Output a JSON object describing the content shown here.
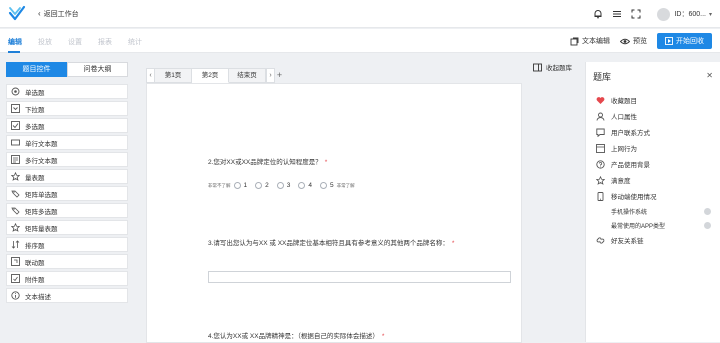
{
  "header": {
    "back_label": "返回工作台",
    "user_id": "ID：600...",
    "icons": [
      "bell-icon",
      "menu-icon",
      "expand-icon",
      "avatar",
      "chevron-down-icon"
    ]
  },
  "steps": {
    "items": [
      "编辑",
      "投放",
      "设置",
      "报表",
      "统计"
    ],
    "active_index": 0
  },
  "actions": {
    "text_edit": "文本编辑",
    "preview": "预览",
    "start": "开始回收"
  },
  "colors": {
    "accent": "#1e88e5",
    "required": "#e5484d",
    "heart": "#e5484d"
  },
  "left_panel": {
    "tabs": [
      "题目控件",
      "问卷大纲"
    ],
    "active_tab": 0,
    "items": [
      {
        "label": "单选题",
        "icon": "radio-icon"
      },
      {
        "label": "下拉题",
        "icon": "dropdown-icon"
      },
      {
        "label": "多选题",
        "icon": "checkbox-icon"
      },
      {
        "label": "单行文本题",
        "icon": "single-line-text-icon"
      },
      {
        "label": "多行文本题",
        "icon": "multi-line-text-icon"
      },
      {
        "label": "量表题",
        "icon": "scale-icon"
      },
      {
        "label": "矩阵单选题",
        "icon": "matrix-radio-icon"
      },
      {
        "label": "矩阵多选题",
        "icon": "matrix-checkbox-icon"
      },
      {
        "label": "矩阵量表题",
        "icon": "matrix-scale-icon"
      },
      {
        "label": "排序题",
        "icon": "sort-icon"
      },
      {
        "label": "联动题",
        "icon": "link-icon"
      },
      {
        "label": "附件题",
        "icon": "attachment-icon"
      },
      {
        "label": "文本描述",
        "icon": "info-icon"
      }
    ]
  },
  "page_tabs": {
    "items": [
      "第1页",
      "第2页",
      "结束页"
    ],
    "active_index": 1
  },
  "survey": {
    "q2": "2.您对XX或XX品牌定位的认知程度是？",
    "scale_low": "非常不了解",
    "scale_high": "非常了解",
    "scale_options": [
      "1",
      "2",
      "3",
      "4",
      "5"
    ],
    "q3": "3.请写出您认为与XX 或 XX品牌定位基本相符且具有参考意义的其他两个品牌名称：",
    "q4": "4.您认为XX或 XX品牌精神是：（根据自己的实际体会描述）",
    "required_mark": "*"
  },
  "collect_label": "收起题库",
  "question_bank": {
    "title": "题库",
    "items": [
      {
        "label": "收藏题目",
        "icon": "heart-icon"
      },
      {
        "label": "人口属性",
        "icon": "person-icon"
      },
      {
        "label": "用户联系方式",
        "icon": "contact-icon"
      },
      {
        "label": "上网行为",
        "icon": "browser-icon"
      },
      {
        "label": "产品使用背景",
        "icon": "help-icon"
      },
      {
        "label": "满意度",
        "icon": "star-icon"
      },
      {
        "label": "移动端使用情况",
        "icon": "mobile-icon"
      }
    ],
    "subitems": [
      "手机操作系统",
      "最常使用的APP类型"
    ],
    "last_item": {
      "label": "好友关系链",
      "icon": "friends-icon"
    }
  }
}
